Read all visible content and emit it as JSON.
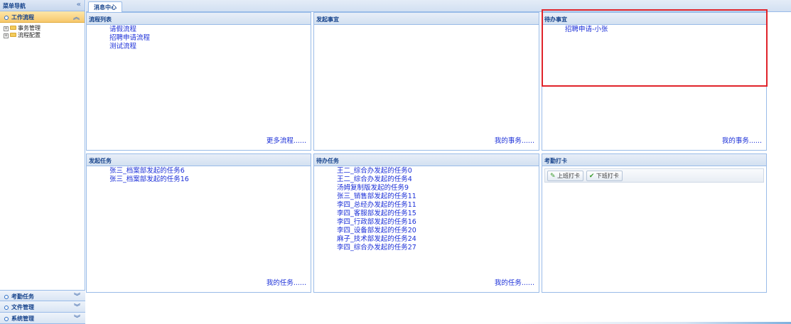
{
  "nav": {
    "title": "菜单导航",
    "collapse_icon": "double-chevron-left-icon",
    "sections": [
      {
        "label": "工作流程",
        "active": true
      },
      {
        "label": "考勤任务",
        "active": false
      },
      {
        "label": "文件管理",
        "active": false
      },
      {
        "label": "系统管理",
        "active": false
      }
    ],
    "tree": [
      {
        "label": "事务管理"
      },
      {
        "label": "流程配置"
      }
    ]
  },
  "tabs": [
    {
      "label": "消息中心"
    }
  ],
  "panels": {
    "flow_list": {
      "title": "流程列表",
      "items": [
        "请假流程",
        "招聘申请流程",
        "测试流程"
      ],
      "more": "更多流程......"
    },
    "started": {
      "title": "发起事宜",
      "items": [],
      "more": "我的事务......"
    },
    "todo": {
      "title": "待办事宜",
      "items": [
        "招聘申请-小张"
      ],
      "more": "我的事务......"
    },
    "sent_tasks": {
      "title": "发起任务",
      "items": [
        "张三_档案部发起的任务6",
        "张三_档案部发起的任务16"
      ],
      "more": "我的任务......"
    },
    "todo_tasks": {
      "title": "待办任务",
      "items": [
        "王二_综合办发起的任务0",
        "王二_综合办发起的任务4",
        "汤姆复制版发起的任务9",
        "张三_销售部发起的任务11",
        "李四_总经办发起的任务11",
        "李四_客服部发起的任务15",
        "李四_行政部发起的任务16",
        "李四_设备部发起的任务20",
        "麻子_技术部发起的任务24",
        "李四_综合办发起的任务27"
      ],
      "more": "我的任务......"
    },
    "attendance": {
      "title": "考勤打卡",
      "buttons": [
        {
          "label": "上班打卡",
          "icon": "pencil-icon"
        },
        {
          "label": "下班打卡",
          "icon": "check-icon"
        }
      ]
    }
  },
  "colors": {
    "highlight": "#e0232a",
    "link": "#1b2fd8",
    "accent": "#15428b"
  }
}
